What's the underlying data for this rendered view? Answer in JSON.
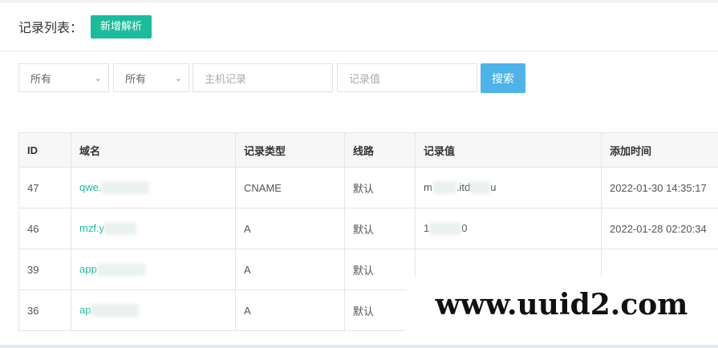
{
  "header": {
    "title": "记录列表：",
    "add_button": "新增解析"
  },
  "filters": {
    "domain_select": "所有",
    "type_select": "所有",
    "host_placeholder": "主机记录",
    "value_placeholder": "记录值",
    "search_button": "搜索"
  },
  "table": {
    "columns": [
      "ID",
      "域名",
      "记录类型",
      "线路",
      "记录值",
      "添加时间"
    ],
    "rows": [
      {
        "id": "47",
        "domain": "qwe.",
        "type": "CNAME",
        "line": "默认",
        "value": "m",
        "value_tail": ".itd",
        "value_end": "u",
        "time": "2022-01-30 14:35:17"
      },
      {
        "id": "46",
        "domain": "mzf.y",
        "type": "A",
        "line": "默认",
        "value": "1",
        "value_tail": "",
        "value_end": "0",
        "time": "2022-01-28 02:20:34"
      },
      {
        "id": "39",
        "domain": "app",
        "type": "A",
        "line": "默认",
        "value": "",
        "value_tail": "",
        "value_end": "",
        "time": ""
      },
      {
        "id": "36",
        "domain": "ap",
        "type": "A",
        "line": "默认",
        "value": "",
        "value_tail": "",
        "value_end": "",
        "time": ""
      }
    ]
  },
  "watermark": "www.uuid2.com",
  "colors": {
    "accent_green": "#1abc9c",
    "search_blue": "#4db3e9"
  }
}
